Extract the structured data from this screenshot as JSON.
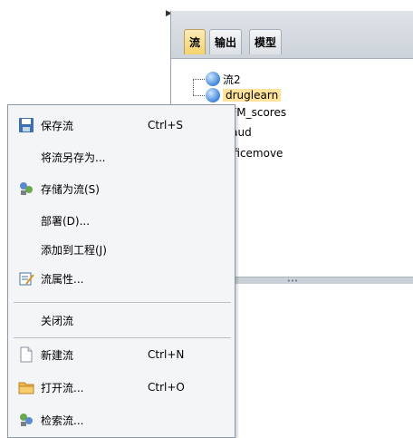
{
  "tabs": [
    {
      "label": "流",
      "active": true
    },
    {
      "label": "输出",
      "active": false
    },
    {
      "label": "模型",
      "active": false
    }
  ],
  "streams": [
    {
      "label": "流2",
      "selected": false
    },
    {
      "label": "druglearn",
      "selected": true
    },
    {
      "label": "RFM_scores",
      "selected": false
    },
    {
      "label": "fraud",
      "selected": false
    },
    {
      "label": "officemove",
      "selected": false
    }
  ],
  "menu": {
    "save": {
      "label": "保存流",
      "shortcut": "Ctrl+S",
      "icon": "save-icon"
    },
    "save_as": {
      "label": "将流另存为..."
    },
    "store": {
      "label": "存储为流(S)",
      "icon": "store-icon"
    },
    "deploy": {
      "label": "部署(D)..."
    },
    "add_project": {
      "label": "添加到工程(J)"
    },
    "properties": {
      "label": "流属性...",
      "icon": "properties-icon"
    },
    "close": {
      "label": "关闭流"
    },
    "new": {
      "label": "新建流",
      "shortcut": "Ctrl+N",
      "icon": "new-file-icon"
    },
    "open": {
      "label": "打开流...",
      "shortcut": "Ctrl+O",
      "icon": "folder-icon"
    },
    "retrieve": {
      "label": "检索流...",
      "icon": "retrieve-icon"
    }
  },
  "colors": {
    "selected_highlight": "#ffe39a",
    "active_tab": "#f5d36b",
    "menu_bg": "#f4f5f7"
  }
}
